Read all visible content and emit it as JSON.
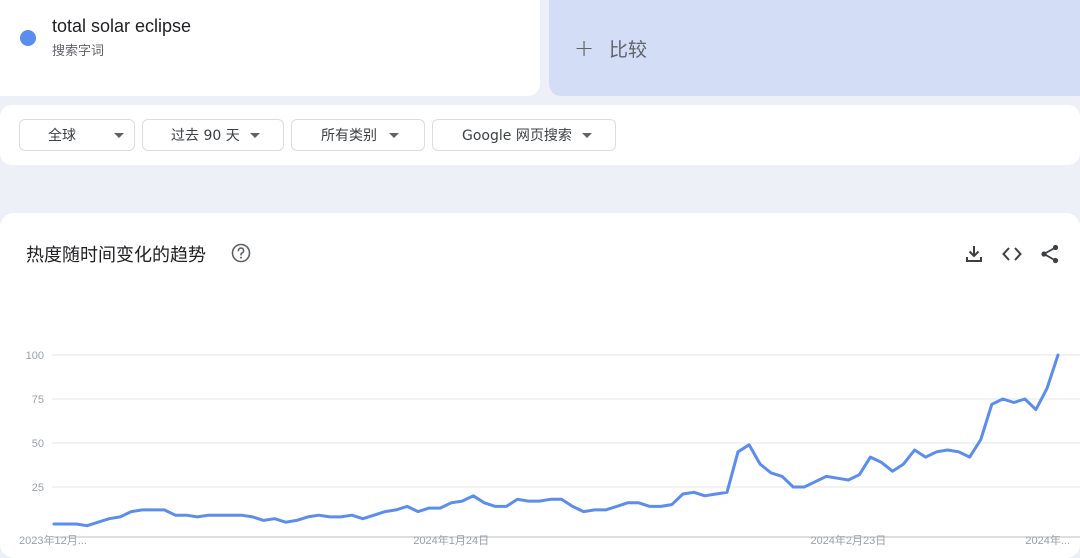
{
  "term": {
    "name": "total solar eclipse",
    "type": "搜索字词",
    "color": "#5b8def"
  },
  "compare": {
    "label": "比较",
    "icon": "plus-icon"
  },
  "filters": [
    {
      "label": "全球"
    },
    {
      "label": "过去 90 天"
    },
    {
      "label": "所有类别"
    },
    {
      "label": "Google 网页搜索"
    }
  ],
  "panel": {
    "title": "热度随时间变化的趋势",
    "icons": [
      "help-icon",
      "download-icon",
      "embed-icon",
      "share-icon"
    ]
  },
  "chart_data": {
    "type": "line",
    "title": "",
    "xlabel": "",
    "ylabel": "",
    "ylim": [
      0,
      100
    ],
    "y_ticks": [
      25,
      50,
      75,
      100
    ],
    "x_tick_labels": [
      "2023年12月...",
      "2024年1月24日",
      "2024年2月23日",
      "2024年..."
    ],
    "x_tick_indices": [
      0,
      36,
      72,
      108
    ],
    "grid": true,
    "partial_from_index": 106,
    "series": [
      {
        "name": "total solar eclipse",
        "color": "#5b8def",
        "values": [
          4,
          4,
          4,
          3,
          5,
          7,
          8,
          11,
          12,
          12,
          12,
          9,
          9,
          8,
          9,
          9,
          9,
          9,
          8,
          6,
          7,
          5,
          6,
          8,
          9,
          8,
          8,
          9,
          7,
          9,
          11,
          12,
          14,
          11,
          13,
          13,
          16,
          17,
          20,
          16,
          14,
          14,
          18,
          17,
          17,
          18,
          18,
          14,
          11,
          12,
          12,
          14,
          16,
          16,
          14,
          14,
          15,
          21,
          22,
          20,
          21,
          22,
          45,
          49,
          38,
          33,
          31,
          25,
          25,
          28,
          31,
          30,
          29,
          32,
          42,
          39,
          34,
          38,
          46,
          42,
          45,
          46,
          45,
          42,
          52,
          72,
          75,
          73,
          75,
          69,
          81,
          100
        ]
      }
    ]
  }
}
